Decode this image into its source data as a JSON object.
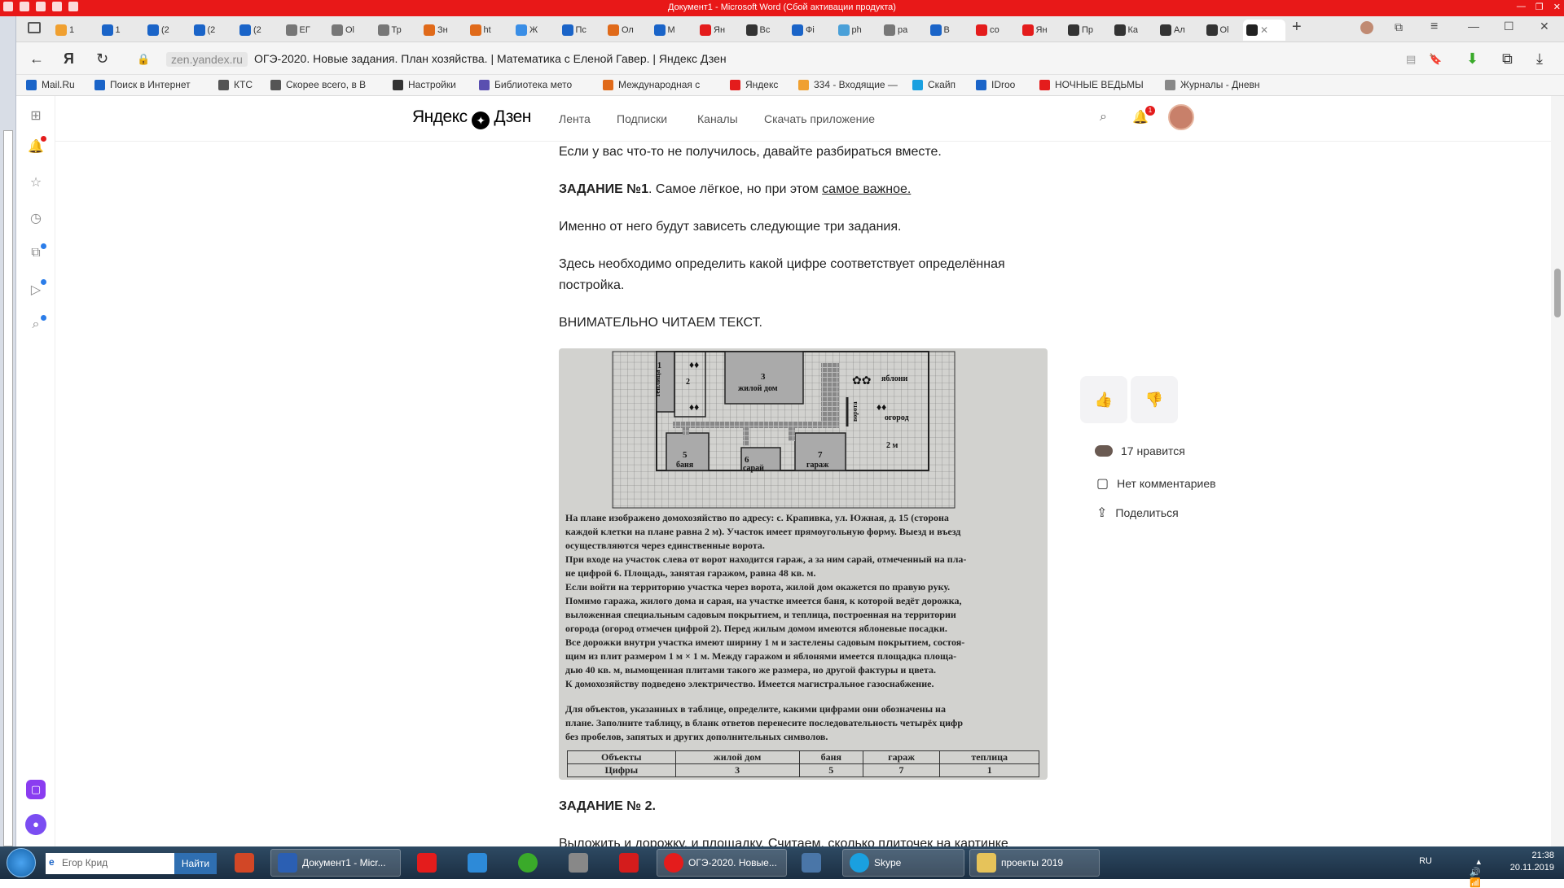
{
  "word": {
    "title": "Документ1 - Microsoft Word (Сбой активации продукта)"
  },
  "browser": {
    "tabs": [
      {
        "label": "1",
        "color": "#f0a030"
      },
      {
        "label": "1",
        "color": "#1a64c8"
      },
      {
        "label": "(2",
        "color": "#1a64c8"
      },
      {
        "label": "(2",
        "color": "#1a64c8"
      },
      {
        "label": "(2",
        "color": "#1a64c8"
      },
      {
        "label": "ЕГ",
        "color": "#777"
      },
      {
        "label": "Ol",
        "color": "#777"
      },
      {
        "label": "Тр",
        "color": "#777"
      },
      {
        "label": "Зн",
        "color": "#e06a1a"
      },
      {
        "label": "ht",
        "color": "#e06a1a"
      },
      {
        "label": "Ж",
        "color": "#3a8ee6"
      },
      {
        "label": "Пс",
        "color": "#1a64c8"
      },
      {
        "label": "Ол",
        "color": "#e06a1a"
      },
      {
        "label": "М",
        "color": "#1a64c8"
      },
      {
        "label": "Ян",
        "color": "#e41c1c"
      },
      {
        "label": "Вс",
        "color": "#333"
      },
      {
        "label": "Фі",
        "color": "#1a64c8"
      },
      {
        "label": "ph",
        "color": "#4aa0d8"
      },
      {
        "label": "pa",
        "color": "#777"
      },
      {
        "label": "В",
        "color": "#1a64c8"
      },
      {
        "label": "со",
        "color": "#e41c1c"
      },
      {
        "label": "Ян",
        "color": "#e41c1c"
      },
      {
        "label": "Пр",
        "color": "#333"
      },
      {
        "label": "Ка",
        "color": "#333"
      },
      {
        "label": "Ал",
        "color": "#333"
      },
      {
        "label": "Ol",
        "color": "#333"
      }
    ],
    "url_host": "zen.yandex.ru",
    "url_title": "ОГЭ-2020. Новые задания. План хозяйства. | Математика с Еленой Гавер. | Яндекс Дзен",
    "bookmarks": [
      {
        "label": "Mail.Ru",
        "color": "#1a64c8"
      },
      {
        "label": "Поиск в Интернет",
        "color": "#1a64c8"
      },
      {
        "label": "КТС",
        "color": "#555"
      },
      {
        "label": "Скорее всего, в В",
        "color": "#555"
      },
      {
        "label": "Настройки",
        "color": "#333"
      },
      {
        "label": "Библиотека мето",
        "color": "#5a4fb0"
      },
      {
        "label": "Международная с",
        "color": "#e06a1a"
      },
      {
        "label": "Яндекс",
        "color": "#e41c1c"
      },
      {
        "label": "334 - Входящие —",
        "color": "#f0a030"
      },
      {
        "label": "Скайп",
        "color": "#1aa0e0"
      },
      {
        "label": "IDroo",
        "color": "#1a64c8"
      },
      {
        "label": "НОЧНЫЕ ВЕДЬМЫ",
        "color": "#e41c1c"
      },
      {
        "label": "Журналы - Дневн",
        "color": "#888"
      }
    ]
  },
  "zen": {
    "logo": "Яндекс",
    "logo_suffix": "Дзен",
    "nav": [
      "Лента",
      "Подписки",
      "Каналы",
      "Скачать приложение"
    ],
    "notification_badge": "1"
  },
  "article": {
    "p1": "Если у вас что-то не получилось, давайте разбираться вместе.",
    "task1_label": "ЗАДАНИЕ №1",
    "task1_text": ". Самое лёгкое, но при этом ",
    "task1_link": "самое важное.",
    "p3": "Именно от него будут зависеть следующие три задания.",
    "p4": "Здесь необходимо определить какой цифре соответствует определённая постройка.",
    "p5": "ВНИМАТЕЛЬНО ЧИТАЕМ ТЕКСТ.",
    "task2": "ЗАДАНИЕ № 2.",
    "p_cut": "Выложить и дорожку, и площадку. Считаем, сколько плиточек на картинке"
  },
  "scan": {
    "plan_labels": {
      "greenhouse": "теплица",
      "house_num": "3",
      "house": "жилой дом",
      "apples": "яблони",
      "garden": "огород",
      "gate": "ворота",
      "scale": "2 м",
      "bath_num": "5",
      "bath": "баня",
      "shed_num": "6",
      "shed": "сарай",
      "garage_num": "7",
      "garage": "гараж",
      "plot_num": "2",
      "greenhouse_num": "1"
    },
    "lines": [
      "На плане изображено домохозяйство по адресу: с. Крапивка, ул. Южная, д. 15 (сторона",
      "каждой клетки на плане равна 2 м). Участок имеет прямоугольную форму. Выезд и въезд",
      "осуществляются через единственные ворота.",
      "При входе на участок слева от ворот находится гараж, а за ним сарай, отмеченный на пла-",
      "не цифрой 6. Площадь, занятая гаражом, равна 48 кв. м.",
      "Если войти на территорию участка через ворота, жилой дом окажется по правую руку.",
      "Помимо гаража, жилого дома и сарая, на участке имеется баня, к которой ведёт дорожка,",
      "выложенная специальным садовым покрытием, и теплица, построенная на территории",
      "огорода (огород отмечен цифрой 2). Перед жилым домом имеются яблоневые посадки.",
      "Все дорожки внутри участка имеют ширину 1 м и застелены садовым покрытием, состоя-",
      "щим из плит размером 1 м × 1 м. Между гаражом и яблонями имеется площадка площа-",
      "дью 40 кв. м, вымощенная плитами такого же размера, но другой фактуры и цвета.",
      "К домохозяйству подведено электричество. Имеется магистральное газоснабжение."
    ],
    "instr": [
      "Для объектов, указанных в таблице, определите, какими цифрами они обозначены на",
      "плане. Заполните таблицу, в бланк ответов перенесите последовательность четырёх цифр",
      "без пробелов, запятых и других дополнительных символов."
    ],
    "table": {
      "row1_head": "Объекты",
      "row2_head": "Цифры",
      "cols": [
        {
          "name": "жилой дом",
          "digit": "3"
        },
        {
          "name": "баня",
          "digit": "5"
        },
        {
          "name": "гараж",
          "digit": "7"
        },
        {
          "name": "теплица",
          "digit": "1"
        }
      ]
    }
  },
  "reactions": {
    "likes": "17 нравится",
    "comments": "Нет комментариев",
    "share": "Поделиться"
  },
  "taskbar": {
    "search_placeholder": "Егор Крид",
    "search_button": "Найти",
    "items": [
      {
        "label": "Документ1 - Micr...",
        "color": "#2b5fb3"
      },
      {
        "label": "ОГЭ-2020. Новые...",
        "color": "#e41c1c"
      },
      {
        "label": "Skype",
        "color": "#1aa0e0"
      },
      {
        "label": "проекты 2019",
        "color": "#e6c35a"
      }
    ],
    "lang": "RU",
    "time": "21:38",
    "date": "20.11.2019"
  }
}
